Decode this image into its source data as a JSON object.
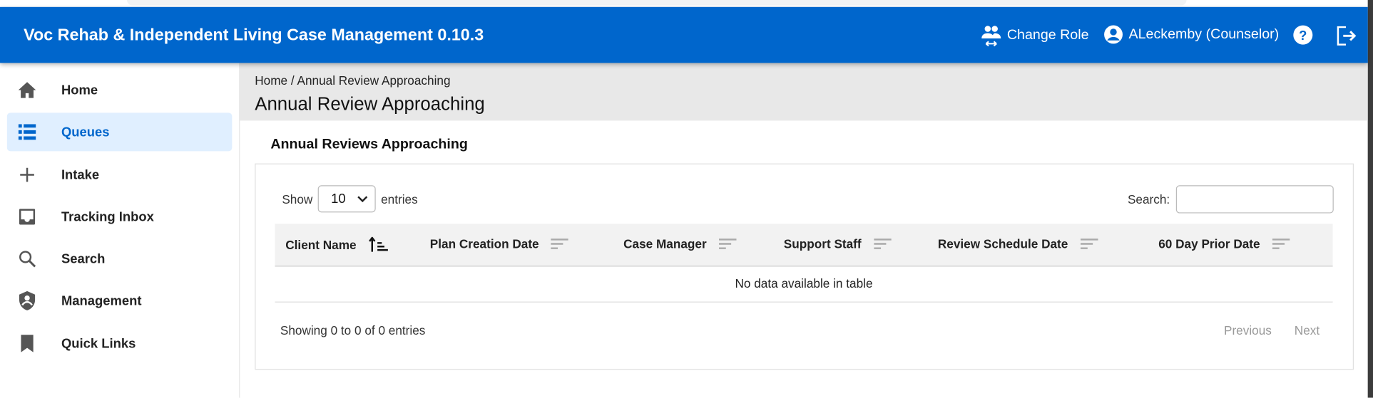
{
  "header": {
    "title": "Voc Rehab & Independent Living Case Management 0.10.3",
    "change_role": "Change Role",
    "user": "ALeckemby (Counselor)",
    "help_icon": "help-circle-icon",
    "logout_icon": "logout-icon",
    "color": "#0066cc"
  },
  "sidebar": {
    "items": [
      {
        "label": "Home",
        "icon": "home-icon"
      },
      {
        "label": "Queues",
        "icon": "list-icon",
        "active": true
      },
      {
        "label": "Intake",
        "icon": "plus-icon"
      },
      {
        "label": "Tracking Inbox",
        "icon": "inbox-icon"
      },
      {
        "label": "Search",
        "icon": "search-icon"
      },
      {
        "label": "Management",
        "icon": "shield-user-icon"
      },
      {
        "label": "Quick Links",
        "icon": "bookmark-icon"
      }
    ]
  },
  "breadcrumb": {
    "home": "Home",
    "sep": "/",
    "current": "Annual Review Approaching"
  },
  "page_title": "Annual Review Approaching",
  "section_title": "Annual Reviews Approaching",
  "table": {
    "show_label": "Show",
    "entries_value": "10",
    "entries_label": "entries",
    "search_label": "Search:",
    "search_value": "",
    "columns": [
      "Client Name",
      "Plan Creation Date",
      "Case Manager",
      "Support Staff",
      "Review Schedule Date",
      "60 Day Prior Date"
    ],
    "empty_text": "No data available in table",
    "info": "Showing 0 to 0 of 0 entries",
    "previous": "Previous",
    "next": "Next"
  }
}
